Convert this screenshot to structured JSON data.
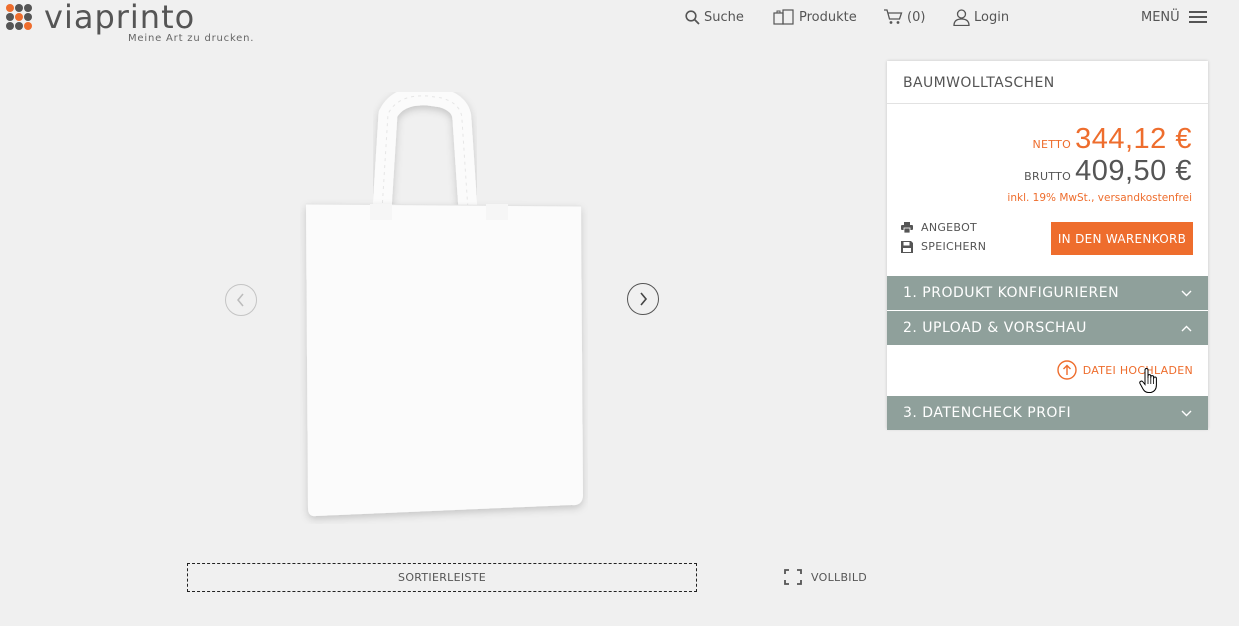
{
  "brand": {
    "name": "viaprinto",
    "tagline": "Meine Art zu drucken.",
    "accent": "#ee6d2d",
    "grey": "#555555"
  },
  "nav": {
    "search": "Suche",
    "products": "Produkte",
    "cart": "(0)",
    "login": "Login",
    "menu": "MENÜ"
  },
  "stage": {
    "sortbar": "SORTIERLEISTE",
    "fullscreen": "VOLLBILD",
    "product_image": "white cotton tote bag"
  },
  "panel": {
    "title": "BAUMWOLLTASCHEN",
    "netto_label": "NETTO",
    "netto_value": "344,12 €",
    "brutto_label": "BRUTTO",
    "brutto_value": "409,50 €",
    "vat_note": "inkl. 19% MwSt., versandkostenfrei",
    "offer": "ANGEBOT",
    "save": "SPEICHERN",
    "add_to_cart": "IN DEN WARENKORB",
    "accordion": [
      {
        "label": "1. PRODUKT KONFIGURIEREN",
        "state": "collapsed"
      },
      {
        "label": "2. UPLOAD & VORSCHAU",
        "state": "expanded"
      },
      {
        "label": "3. DATENCHECK PROFI",
        "state": "collapsed"
      }
    ],
    "upload": "DATEI HOCHLADEN"
  },
  "accordion_color": "#8fa09b"
}
